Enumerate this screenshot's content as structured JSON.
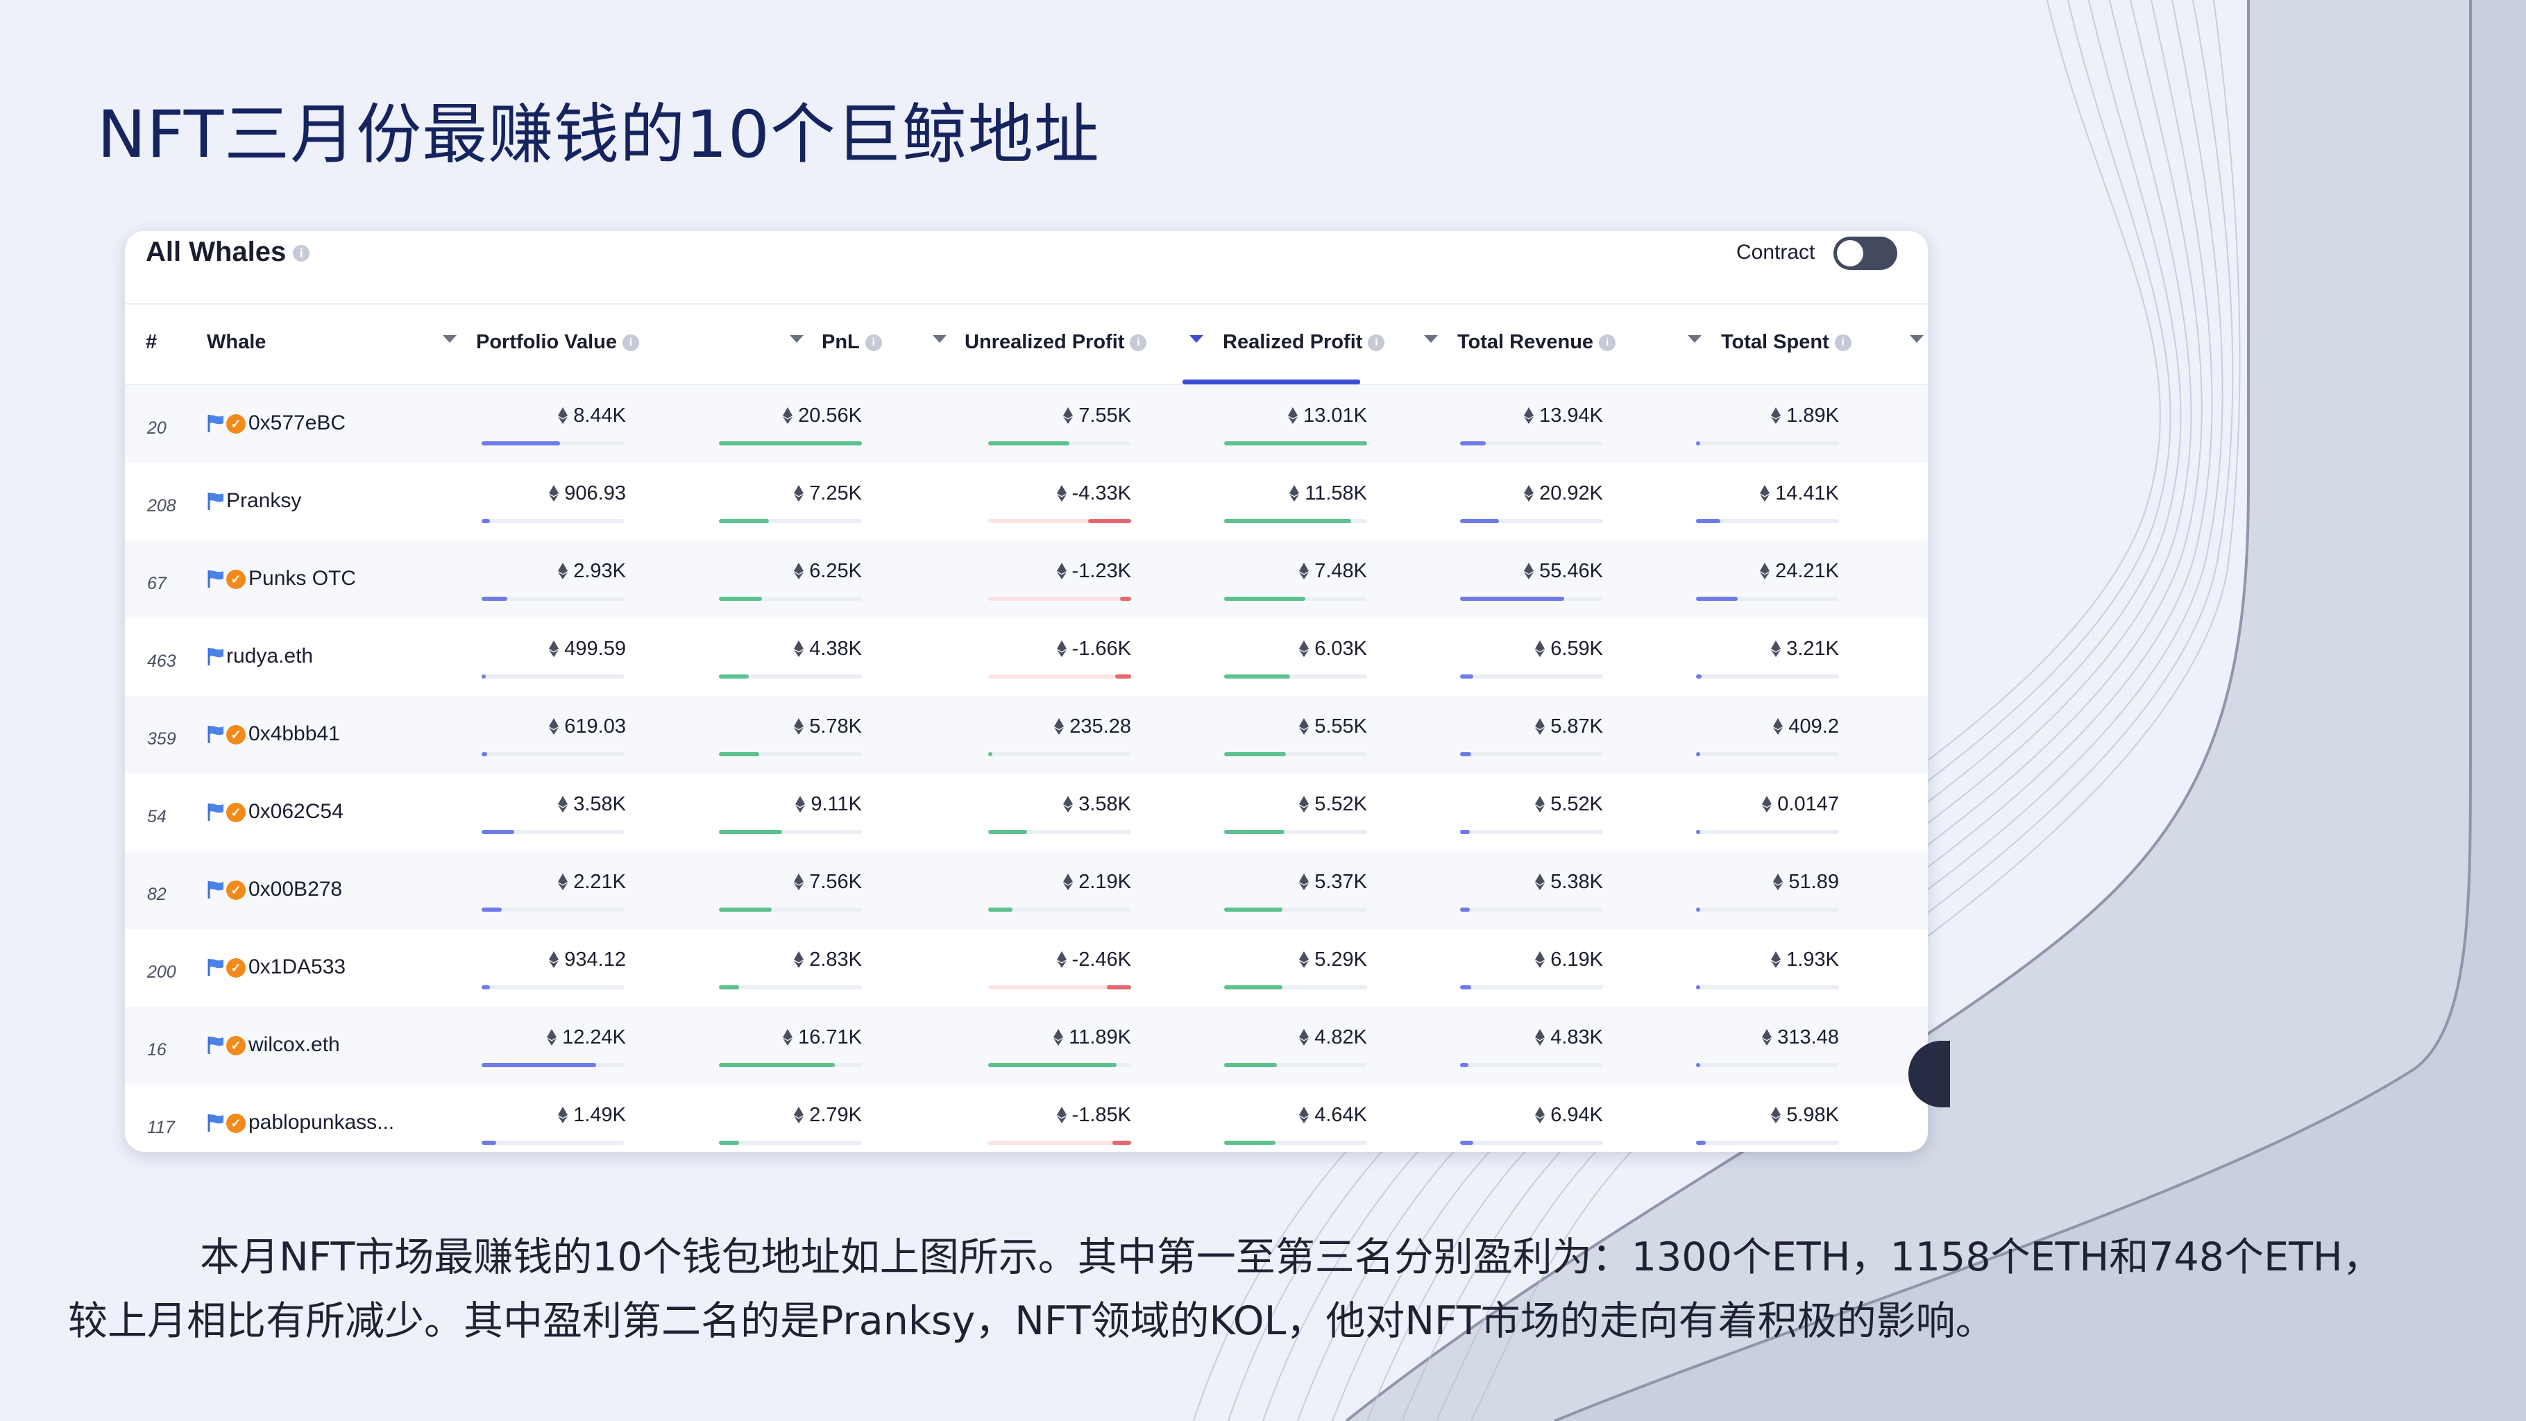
{
  "slide_title": "NFT三月份最赚钱的10个巨鲸地址",
  "card": {
    "title": "All Whales",
    "contract_label": "Contract",
    "contract_toggle_on": false
  },
  "columns": {
    "rank": "#",
    "whale": "Whale",
    "portfolio_value": "Portfolio Value",
    "pnl": "PnL",
    "unrealized_profit": "Unrealized Profit",
    "realized_profit": "Realized Profit",
    "total_revenue": "Total Revenue",
    "total_spent": "Total Spent",
    "active_sort": "Realized Profit"
  },
  "rows": [
    {
      "rank": "20",
      "whale": "0x577eBC",
      "badge": true,
      "portfolio": "8.44K",
      "pnl": "20.56K",
      "unrealized": "7.55K",
      "realized": "13.01K",
      "revenue": "13.94K",
      "spent": "1.89K",
      "bars": {
        "portfolio": 0.55,
        "pnl": 1.0,
        "unrealized": 0.57,
        "realized": 1.0,
        "revenue": 0.18,
        "spent": 0.03
      }
    },
    {
      "rank": "208",
      "whale": "Pranksy",
      "badge": false,
      "portfolio": "906.93",
      "pnl": "7.25K",
      "unrealized": "-4.33K",
      "realized": "11.58K",
      "revenue": "20.92K",
      "spent": "14.41K",
      "bars": {
        "portfolio": 0.06,
        "pnl": 0.35,
        "unrealized": -0.3,
        "realized": 0.89,
        "revenue": 0.27,
        "spent": 0.17
      }
    },
    {
      "rank": "67",
      "whale": "Punks OTC",
      "badge": true,
      "portfolio": "2.93K",
      "pnl": "6.25K",
      "unrealized": "-1.23K",
      "realized": "7.48K",
      "revenue": "55.46K",
      "spent": "24.21K",
      "bars": {
        "portfolio": 0.18,
        "pnl": 0.3,
        "unrealized": -0.08,
        "realized": 0.57,
        "revenue": 0.73,
        "spent": 0.29
      }
    },
    {
      "rank": "463",
      "whale": "rudya.eth",
      "badge": false,
      "portfolio": "499.59",
      "pnl": "4.38K",
      "unrealized": "-1.66K",
      "realized": "6.03K",
      "revenue": "6.59K",
      "spent": "3.21K",
      "bars": {
        "portfolio": 0.03,
        "pnl": 0.21,
        "unrealized": -0.11,
        "realized": 0.46,
        "revenue": 0.09,
        "spent": 0.04
      }
    },
    {
      "rank": "359",
      "whale": "0x4bbb41",
      "badge": true,
      "portfolio": "619.03",
      "pnl": "5.78K",
      "unrealized": "235.28",
      "realized": "5.55K",
      "revenue": "5.87K",
      "spent": "409.2",
      "bars": {
        "portfolio": 0.04,
        "pnl": 0.28,
        "unrealized": 0.02,
        "realized": 0.43,
        "revenue": 0.08,
        "spent": 0.01
      }
    },
    {
      "rank": "54",
      "whale": "0x062C54",
      "badge": true,
      "portfolio": "3.58K",
      "pnl": "9.11K",
      "unrealized": "3.58K",
      "realized": "5.52K",
      "revenue": "5.52K",
      "spent": "0.0147",
      "bars": {
        "portfolio": 0.23,
        "pnl": 0.44,
        "unrealized": 0.27,
        "realized": 0.42,
        "revenue": 0.07,
        "spent": 0.0
      }
    },
    {
      "rank": "82",
      "whale": "0x00B278",
      "badge": true,
      "portfolio": "2.21K",
      "pnl": "7.56K",
      "unrealized": "2.19K",
      "realized": "5.37K",
      "revenue": "5.38K",
      "spent": "51.89",
      "bars": {
        "portfolio": 0.14,
        "pnl": 0.37,
        "unrealized": 0.17,
        "realized": 0.41,
        "revenue": 0.07,
        "spent": 0.0
      }
    },
    {
      "rank": "200",
      "whale": "0x1DA533",
      "badge": true,
      "portfolio": "934.12",
      "pnl": "2.83K",
      "unrealized": "-2.46K",
      "realized": "5.29K",
      "revenue": "6.19K",
      "spent": "1.93K",
      "bars": {
        "portfolio": 0.06,
        "pnl": 0.14,
        "unrealized": -0.17,
        "realized": 0.41,
        "revenue": 0.08,
        "spent": 0.02
      }
    },
    {
      "rank": "16",
      "whale": "wilcox.eth",
      "badge": true,
      "portfolio": "12.24K",
      "pnl": "16.71K",
      "unrealized": "11.89K",
      "realized": "4.82K",
      "revenue": "4.83K",
      "spent": "313.48",
      "bars": {
        "portfolio": 0.8,
        "pnl": 0.81,
        "unrealized": 0.9,
        "realized": 0.37,
        "revenue": 0.06,
        "spent": 0.0
      }
    },
    {
      "rank": "117",
      "whale": "pablopunkass...",
      "badge": true,
      "portfolio": "1.49K",
      "pnl": "2.79K",
      "unrealized": "-1.85K",
      "realized": "4.64K",
      "revenue": "6.94K",
      "spent": "5.98K",
      "bars": {
        "portfolio": 0.1,
        "pnl": 0.14,
        "unrealized": -0.13,
        "realized": 0.36,
        "revenue": 0.09,
        "spent": 0.07
      }
    }
  ],
  "caption": {
    "line1": "本月NFT市场最赚钱的10个钱包地址如上图所示。其中第一至第三名分别盈利为：1300个ETH，1158个ETH和748个ETH，",
    "line2": "较上月相比有所减少。其中盈利第二名的是Pranksy，NFT领域的KOL，他对NFT市场的走向有着积极的影响。"
  },
  "colors": {
    "title": "#15245e",
    "accent": "#3d4cd6",
    "bar_blue": "#6e7bea",
    "bar_green": "#5cc28f",
    "bar_red": "#e5686f",
    "badge_orange": "#f28a1b"
  },
  "icons": {
    "info": "info-icon",
    "sort": "chevron-down-icon",
    "eth": "eth-icon",
    "flag": "flag-icon",
    "badge": "verified-badge-icon"
  }
}
